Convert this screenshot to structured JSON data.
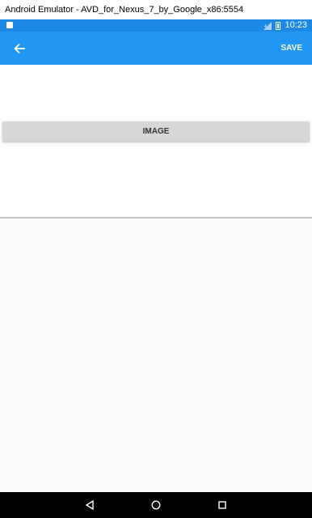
{
  "window": {
    "title": "Android Emulator - AVD_for_Nexus_7_by_Google_x86:5554"
  },
  "status_bar": {
    "time": "10:23"
  },
  "app_bar": {
    "save_label": "SAVE",
    "back_icon": "arrow-back-icon"
  },
  "content": {
    "image_button_label": "IMAGE"
  },
  "nav_bar": {
    "back_icon": "triangle-back-icon",
    "home_icon": "circle-home-icon",
    "recents_icon": "square-recents-icon"
  },
  "colors": {
    "status_bar": "#1e88e5",
    "app_bar": "#2196f3",
    "button": "#d6d7d7"
  }
}
